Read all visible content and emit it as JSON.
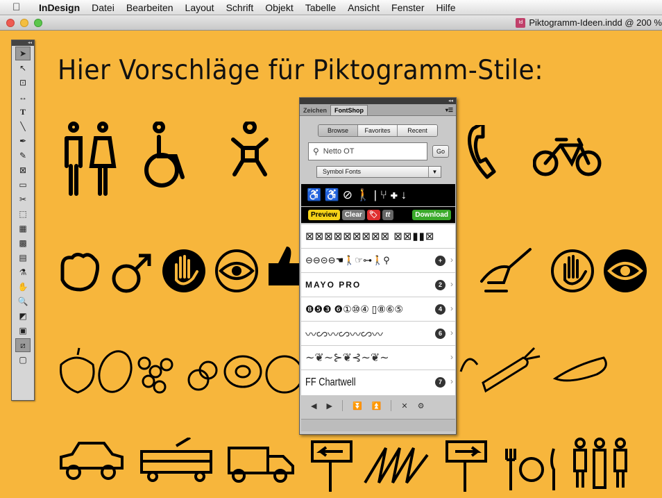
{
  "menubar": {
    "apple_icon": "apple-icon",
    "app_name": "InDesign",
    "items": [
      "Datei",
      "Bearbeiten",
      "Layout",
      "Schrift",
      "Objekt",
      "Tabelle",
      "Ansicht",
      "Fenster",
      "Hilfe"
    ]
  },
  "window": {
    "title": "Piktogramm-Ideen.indd @ 200 %"
  },
  "document": {
    "headline": "Hier Vorschläge für Piktogramm-Stile:"
  },
  "toolbox": {
    "collapse_glyph": "◂◂",
    "tools": [
      "selection-tool",
      "direct-selection-tool",
      "page-tool",
      "gap-tool",
      "type-tool",
      "line-tool",
      "pen-tool",
      "pencil-tool",
      "rectangle-frame-tool",
      "rectangle-tool",
      "scissors-tool",
      "free-transform-tool",
      "gradient-tool",
      "gradient-feather-tool",
      "note-tool",
      "eyedropper-tool",
      "hand-tool",
      "zoom-tool"
    ]
  },
  "fontshop_panel": {
    "collapse_glyph": "◂◂",
    "tabs": [
      "Zeichen",
      "FontShop"
    ],
    "active_tab": "FontShop",
    "mode_buttons": [
      "Browse",
      "Favorites",
      "Recent"
    ],
    "active_mode": "Browse",
    "search_value": "Netto OT",
    "go_label": "Go",
    "category_select": "Symbol Fonts",
    "preview_glyphs": "♿ ♿ ⊘ 🚶 | ⑂ ✚ ↓",
    "buttons": {
      "preview": "Preview",
      "clear": "Clear",
      "tt": "tt",
      "download": "Download"
    },
    "font_rows": [
      {
        "sample": "⊠⊠⊠⊠⊠⊠⊠⊠⊠  ⊠⊠▮▮⊠",
        "badge": ""
      },
      {
        "sample": "⊖⊖⊝⊖☚🚶☞⊶🚶⚲",
        "badge": "+"
      },
      {
        "sample": "MAYO PRO",
        "badge": "2"
      },
      {
        "sample": "❽❺❸ ❻①⑩④ ▯⑧⑥⑤",
        "badge": "4"
      },
      {
        "sample": "〰∽〰∽〰∽〰",
        "badge": "6"
      },
      {
        "sample": "∼❦∼⊱❦⊰∼❦∼",
        "badge": ""
      },
      {
        "sample": "FF Chartwell",
        "badge": "7"
      }
    ]
  }
}
